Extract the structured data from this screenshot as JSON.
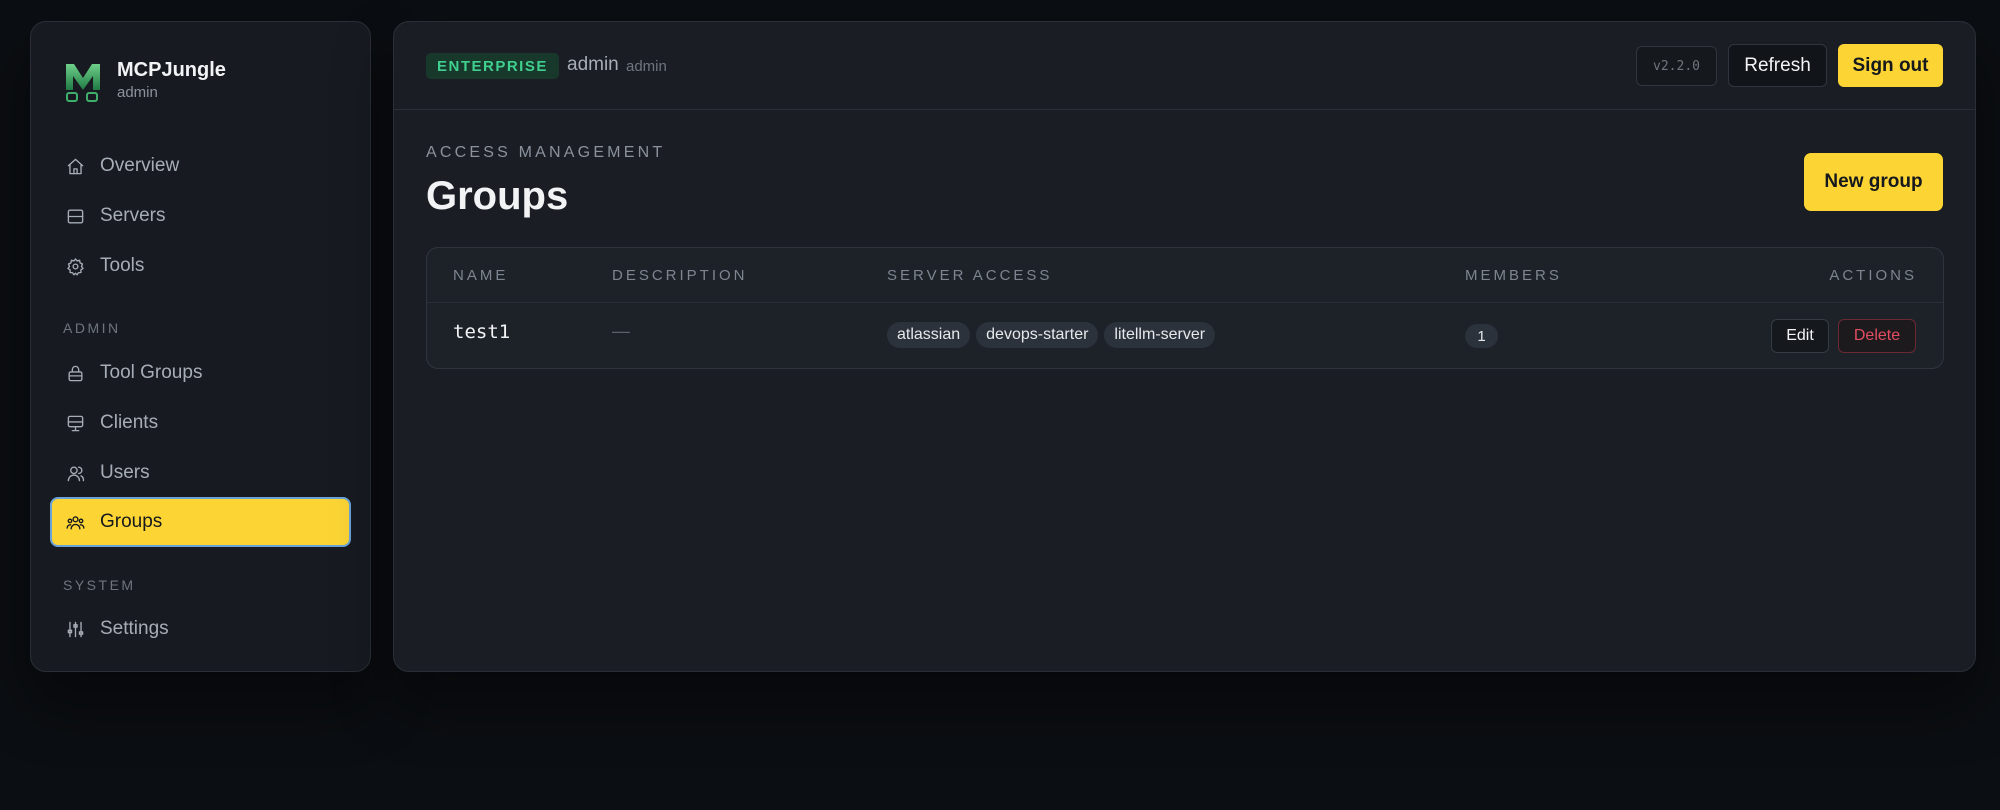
{
  "brand": {
    "name": "MCPJungle",
    "role": "admin"
  },
  "sidebar": {
    "items": [
      {
        "label": "Overview",
        "icon": "home-icon"
      },
      {
        "label": "Servers",
        "icon": "server-icon"
      },
      {
        "label": "Tools",
        "icon": "gear-icon"
      }
    ],
    "admin_label": "ADMIN",
    "admin_items": [
      {
        "label": "Tool Groups",
        "icon": "lock-icon"
      },
      {
        "label": "Clients",
        "icon": "monitor-icon"
      },
      {
        "label": "Users",
        "icon": "users-icon"
      },
      {
        "label": "Groups",
        "icon": "group-icon",
        "active": true
      }
    ],
    "system_label": "SYSTEM",
    "system_items": [
      {
        "label": "Settings",
        "icon": "sliders-icon"
      }
    ]
  },
  "header": {
    "edition_badge": "ENTERPRISE",
    "user_name": "admin",
    "user_role": "admin",
    "version": "v2.2.0",
    "refresh_label": "Refresh",
    "signout_label": "Sign out"
  },
  "page": {
    "eyebrow": "ACCESS MANAGEMENT",
    "title": "Groups",
    "new_button": "New group"
  },
  "table": {
    "headers": {
      "name": "NAME",
      "description": "DESCRIPTION",
      "server_access": "SERVER ACCESS",
      "members": "MEMBERS",
      "actions": "ACTIONS"
    },
    "rows": [
      {
        "name": "test1",
        "description": "—",
        "servers": [
          "atlassian",
          "devops-starter",
          "litellm-server"
        ],
        "members": "1",
        "edit_label": "Edit",
        "delete_label": "Delete"
      }
    ]
  },
  "colors": {
    "accent": "#fcd535",
    "enterprise_green": "#3fcf8e",
    "danger": "#e34d62",
    "background": "#0b0e12"
  }
}
